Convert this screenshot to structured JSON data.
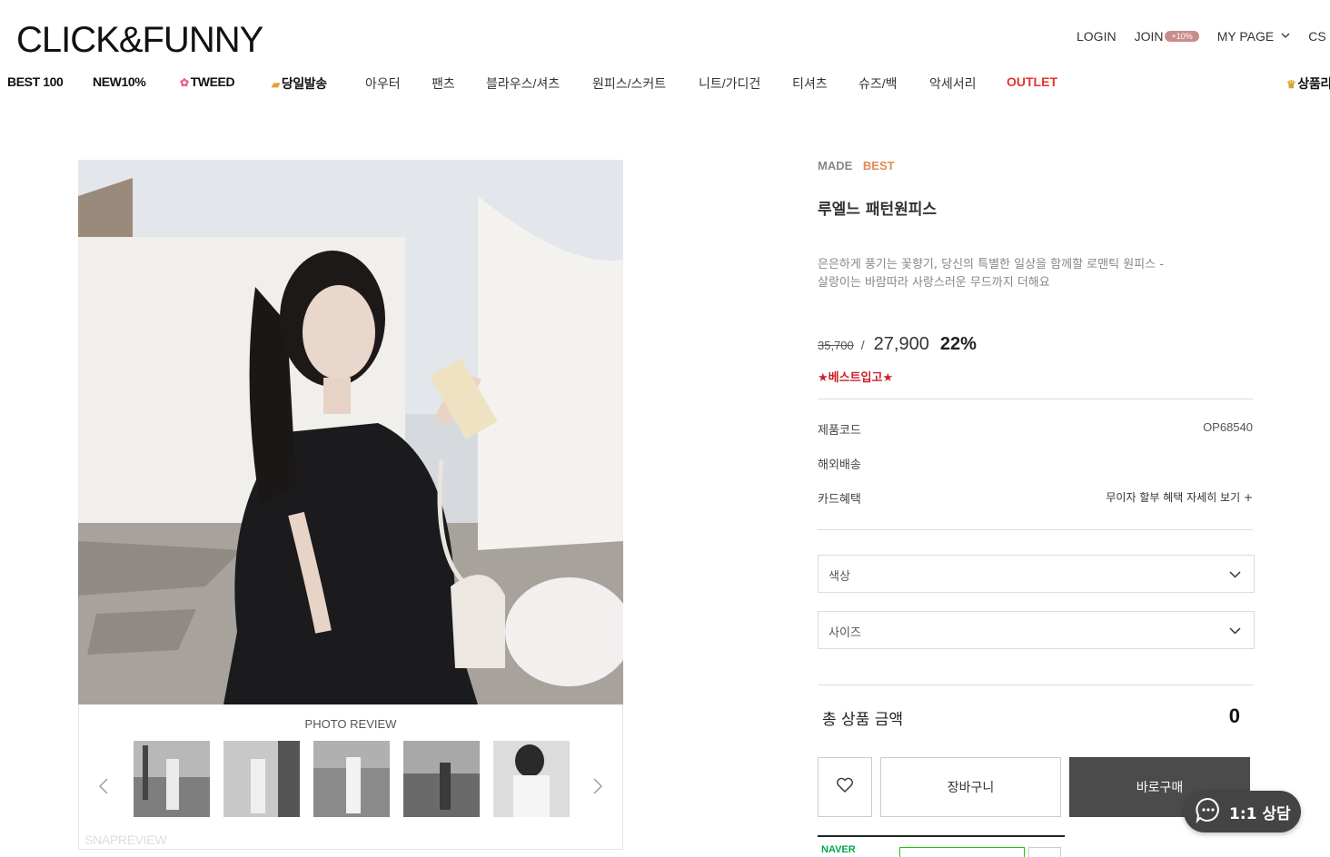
{
  "brand": {
    "logo": "CLICK&FUNNY"
  },
  "top_nav": {
    "login": "LOGIN",
    "join": "JOIN",
    "join_badge": "+10%",
    "mypage": "MY PAGE",
    "cs": "CS"
  },
  "categories": [
    "BEST 100",
    "NEW10%",
    "TWEED",
    "당일발송",
    "아우터",
    "팬츠",
    "블라우스/셔츠",
    "원피스/스커트",
    "니트/가디건",
    "티셔츠",
    "슈즈/백",
    "악세서리",
    "OUTLET",
    "상품리"
  ],
  "gallery": {
    "title": "PHOTO REVIEW",
    "watermark": "SNAPREVIEW",
    "thumbnails": 5
  },
  "product": {
    "tag_made": "MADE",
    "tag_best": "BEST",
    "name": "루엘느 패턴원피스",
    "desc_line1": "은은하게 풍기는 꽃향기, 당신의 특별한 일상을 함께할 로맨틱 원피스 -",
    "desc_line2": "살랑이는 바람따라 사랑스러운 무드까지 더해요",
    "original_price": "35,700",
    "price_sep": "/",
    "sale_price": "27,900",
    "discount": "22%",
    "promo": "★베스트입고★"
  },
  "details": {
    "code_label": "제품코드",
    "code_value": "OP68540",
    "shipping_label": "해외배송",
    "card_label": "카드혜택",
    "card_value": "무이자 할부 혜택 자세히 보기 +"
  },
  "options": {
    "color_placeholder": "색상",
    "size_placeholder": "사이즈"
  },
  "total": {
    "label": "총 상품 금액",
    "value": "0"
  },
  "actions": {
    "cart": "장바구니",
    "buy": "바로구매"
  },
  "naver": {
    "label": "NAVER"
  },
  "chat": {
    "label": "1:1 상담"
  },
  "colors": {
    "outlet": "#e8342b",
    "best": "#e58a56",
    "promo": "#cc1f2a",
    "buy_bg": "#4b4b4b",
    "badge": "#c98c8c"
  }
}
